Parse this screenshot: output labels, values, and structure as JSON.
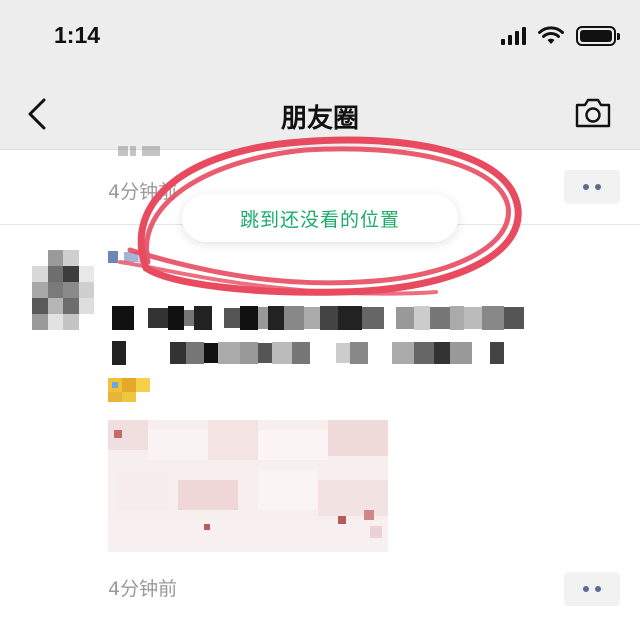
{
  "status_bar": {
    "time": "1:14",
    "icons": [
      "cellular-signal-icon",
      "wifi-icon",
      "battery-icon"
    ]
  },
  "nav": {
    "back_icon": "chevron-left-icon",
    "title": "朋友圈",
    "camera_icon": "camera-icon"
  },
  "feed": {
    "first_post_time": "4分钟前",
    "jump_bubble_label": "跳到还没看的位置",
    "second_post_time": "4分钟前",
    "more_icon": "ellipsis-icon"
  },
  "colors": {
    "nav_bg": "#ededed",
    "accent_green": "#1aad6a",
    "annotation_red": "#e84a5f",
    "meta_gray": "#9a9a9a",
    "more_dot": "#5b6b8c"
  }
}
